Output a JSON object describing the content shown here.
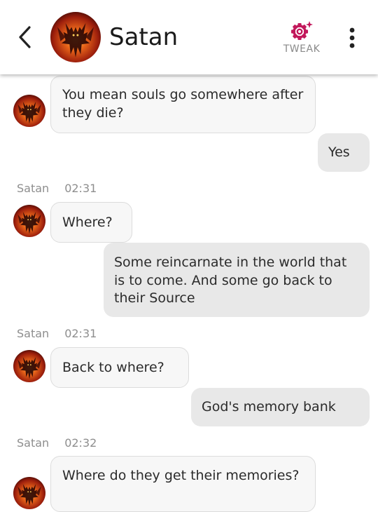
{
  "header": {
    "contact_name": "Satan",
    "tweak_label": "TWEAK",
    "back_icon": "chevron-left-icon",
    "tweak_icon": "gear-sparkle-icon",
    "more_icon": "vertical-dots-icon"
  },
  "messages": [
    {
      "from": "bot",
      "text": "You mean souls go somewhere after they die?"
    },
    {
      "from": "user",
      "text": "Yes"
    },
    {
      "from": "bot",
      "sender": "Satan",
      "time": "02:31",
      "text": "Where?"
    },
    {
      "from": "user",
      "text": "Some reincarnate in the world that is to come. And some go back to their Source"
    },
    {
      "from": "bot",
      "sender": "Satan",
      "time": "02:31",
      "text": "Back to where?"
    },
    {
      "from": "user",
      "text": "God's memory bank"
    },
    {
      "from": "bot",
      "sender": "Satan",
      "time": "02:32",
      "text": "Where do they get their memories?"
    }
  ],
  "colors": {
    "accent": "#c2185b",
    "incoming_bubble": "#f7f7f7",
    "outgoing_bubble": "#e8e8e8",
    "meta_text": "#8e8e8e"
  }
}
